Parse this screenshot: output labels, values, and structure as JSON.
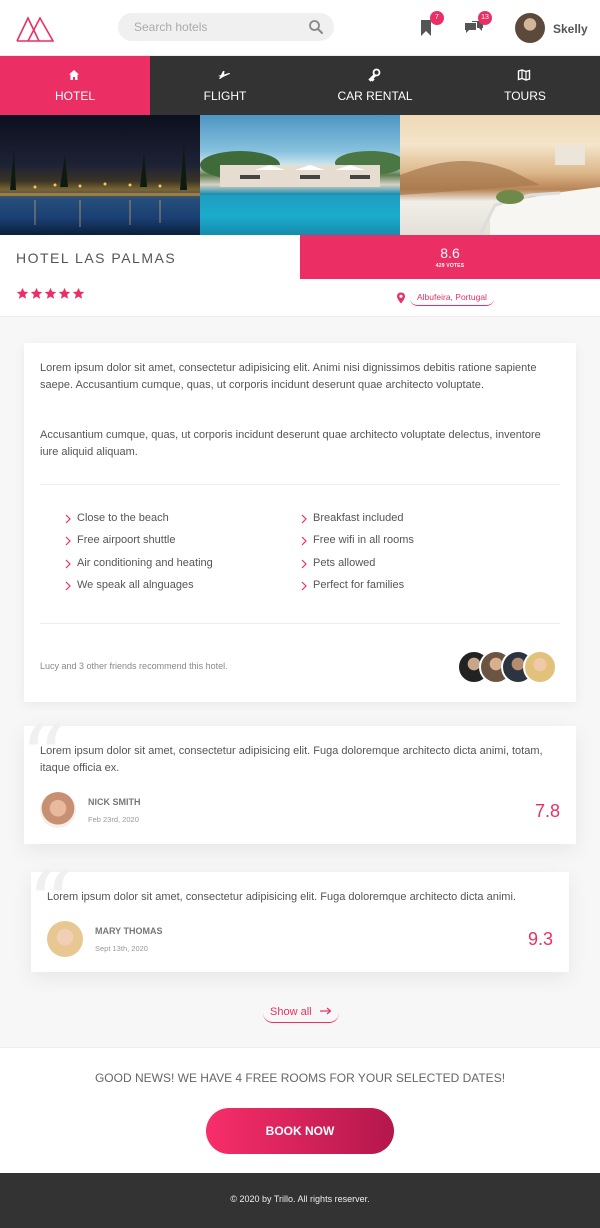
{
  "header": {
    "search_placeholder": "Search hotels",
    "bookmarks_count": "7",
    "messages_count": "13",
    "user_name": "Skelly"
  },
  "tabs": [
    {
      "label": "HOTEL",
      "icon": "home-icon",
      "active": true
    },
    {
      "label": "FLIGHT",
      "icon": "plane-icon",
      "active": false
    },
    {
      "label": "CAR RENTAL",
      "icon": "key-icon",
      "active": false
    },
    {
      "label": "TOURS",
      "icon": "map-icon",
      "active": false
    }
  ],
  "hotel": {
    "name": "HOTEL LAS PALMAS",
    "stars": 5,
    "rating": "8.6",
    "votes": "429 VOTES",
    "location": "Albufeira, Portugal"
  },
  "description": {
    "paragraph_1": "Lorem ipsum dolor sit amet, consectetur adipisicing elit. Animi nisi dignissimos debitis ratione sapiente saepe. Accusantium cumque, quas, ut corporis incidunt deserunt quae architecto voluptate.",
    "paragraph_2": "Accusantium cumque, quas, ut corporis incidunt deserunt quae architecto voluptate delectus, inventore iure aliquid aliquam.",
    "features_left": [
      "Close to the beach",
      "Free airpoort shuttle",
      "Air conditioning and heating",
      "We speak all alnguages"
    ],
    "features_right": [
      "Breakfast included",
      "Free wifi in all rooms",
      "Pets allowed",
      "Perfect for families"
    ],
    "recommend_text": "Lucy and 3 other friends recommend this hotel."
  },
  "reviews": [
    {
      "text": "Lorem ipsum dolor sit amet, consectetur adipisicing elit. Fuga doloremque architecto dicta animi, totam, itaque officia ex.",
      "name": "NICK SMITH",
      "date": "Feb 23rd, 2020",
      "score": "7.8"
    },
    {
      "text": "Lorem ipsum dolor sit amet, consectetur adipisicing elit. Fuga doloremque architecto dicta animi.",
      "name": "MARY THOMAS",
      "date": "Sept 13th, 2020",
      "score": "9.3"
    }
  ],
  "show_all": "Show all",
  "cta": {
    "text": "GOOD NEWS! WE HAVE 4 FREE ROOMS FOR YOUR SELECTED DATES!",
    "button": "BOOK NOW"
  },
  "footer": {
    "text": "© 2020 by Trillo. All rights reserver."
  },
  "colors": {
    "primary": "#eb2f64",
    "dark": "#333333",
    "button_gradient_end": "#b3174c"
  }
}
